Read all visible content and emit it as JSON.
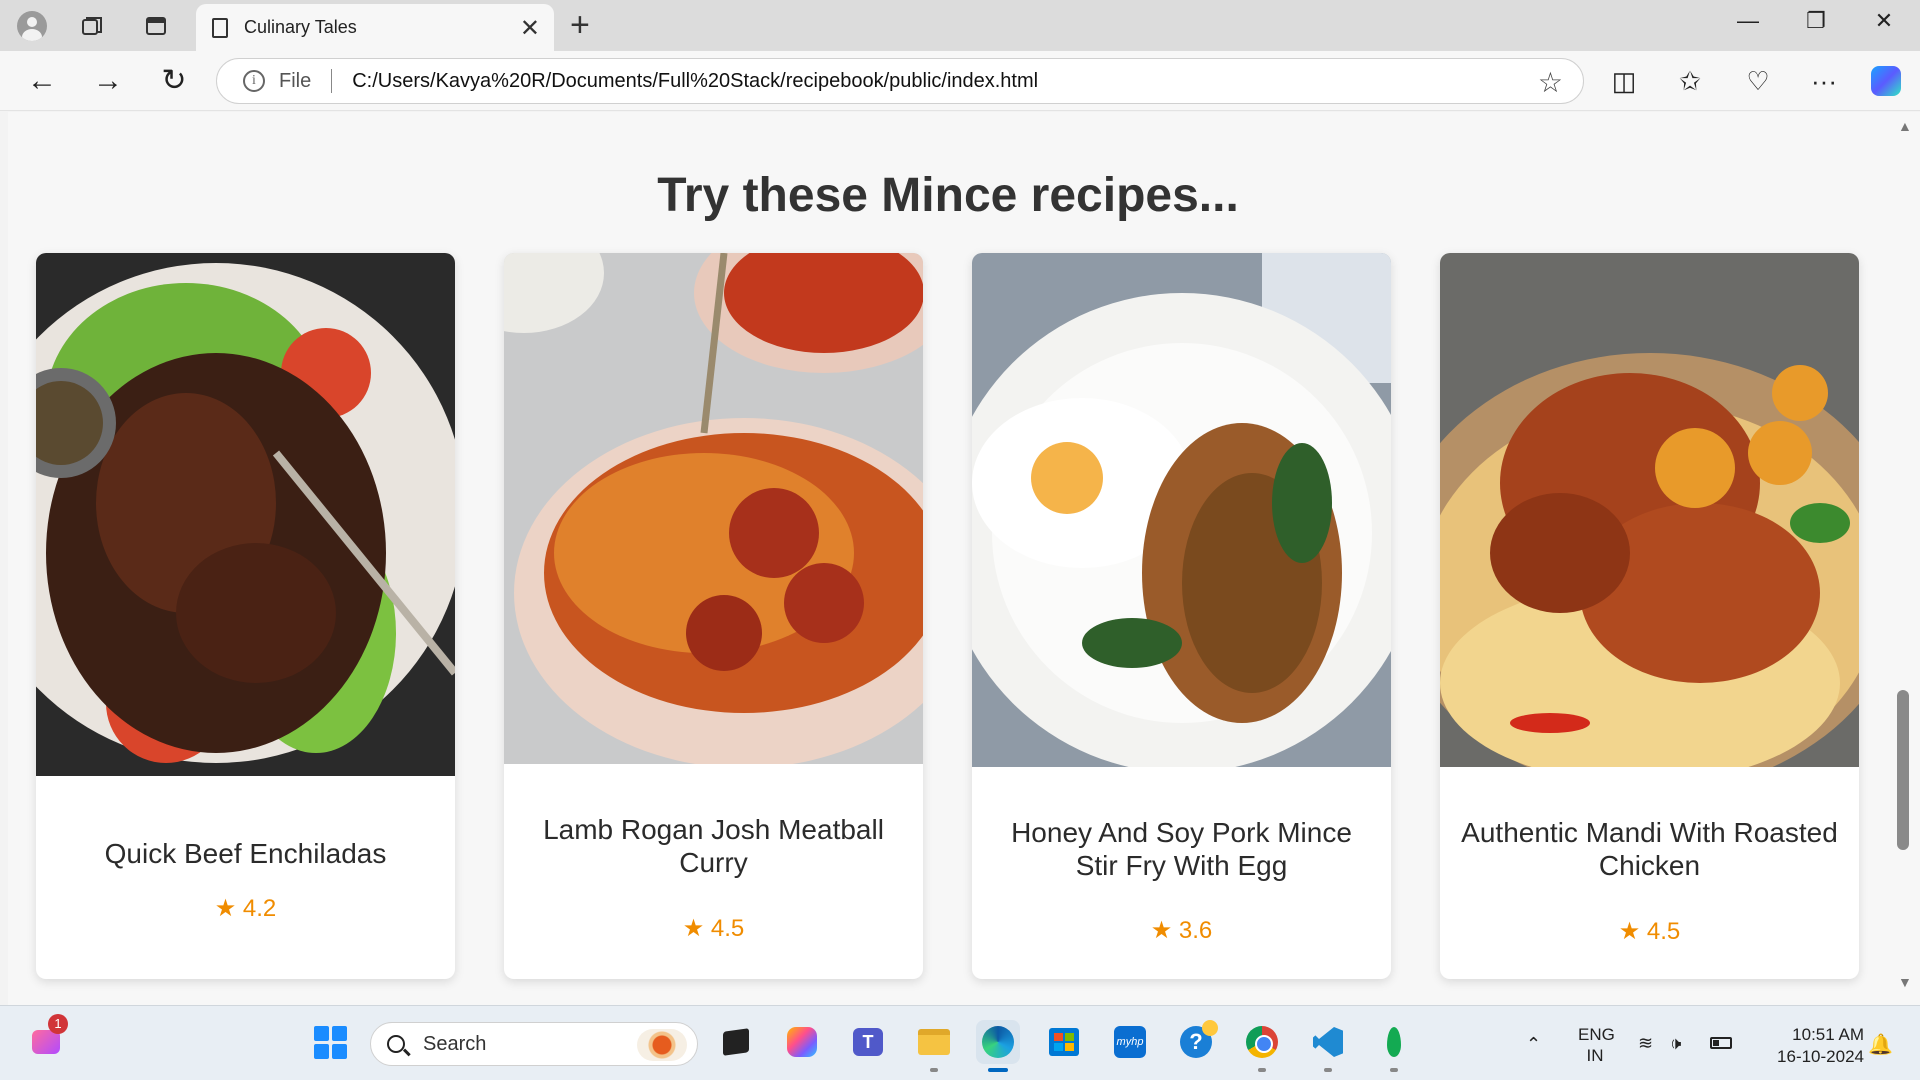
{
  "browser": {
    "tab_title": "Culinary Tales",
    "tab_close": "✕",
    "new_tab": "+",
    "window_controls": {
      "minimize": "—",
      "restore": "❐",
      "close": "✕"
    },
    "nav": {
      "back": "←",
      "forward": "→",
      "reload": "↻"
    },
    "address": {
      "info_glyph": "i",
      "scheme_label": "File",
      "url": "C:/Users/Kavya%20R/Documents/Full%20Stack/recipebook/public/index.html",
      "favorite_glyph": "☆"
    },
    "toolbar": {
      "split": "◫",
      "favorites": "✩",
      "health": "♡",
      "more": "···"
    }
  },
  "page": {
    "heading": "Try these Mince recipes...",
    "recipes": [
      {
        "name": "Quick Beef Enchiladas",
        "rating": "★ 4.2"
      },
      {
        "name": "Lamb Rogan Josh Meatball Curry",
        "rating": "★ 4.5"
      },
      {
        "name": "Honey And Soy Pork Mince Stir Fry With Egg",
        "rating": "★ 3.6"
      },
      {
        "name": "Authentic Mandi With Roasted Chicken",
        "rating": "★ 4.5"
      }
    ]
  },
  "scrollbar": {
    "up": "▲",
    "down": "▼",
    "position_fraction": 0.75
  },
  "taskbar": {
    "notification_badge": "1",
    "search_placeholder": "Search",
    "teams_letter": "T",
    "myhp_label": "myhp",
    "tips_glyph": "?",
    "tray_chevron": "⌃",
    "language": {
      "line1": "ENG",
      "line2": "IN"
    },
    "wifi": "≋",
    "volume": "🕩",
    "time": "10:51 AM",
    "date": "16-10-2024",
    "bell": "🔔"
  },
  "colors": {
    "rating_star": "#f08c00",
    "heading": "#333333",
    "page_background": "#f7f7f7",
    "accent": "#0067c0"
  }
}
